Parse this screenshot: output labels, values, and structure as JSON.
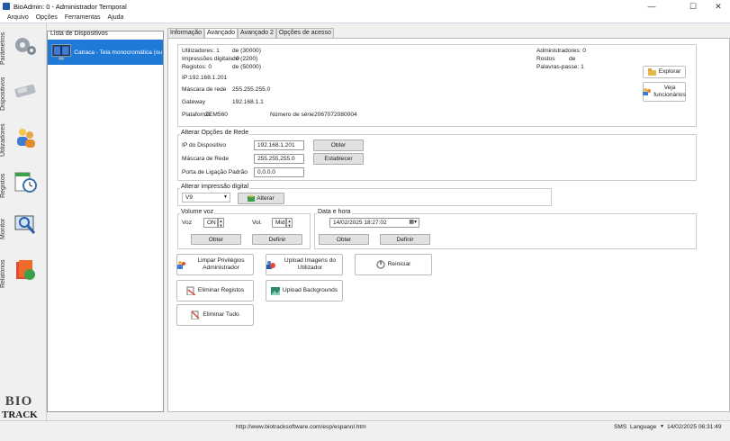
{
  "window": {
    "title": "BioAdmin: 0 - Administrador Temporal"
  },
  "menu": [
    "Arquivo",
    "Opções",
    "Ferramentas",
    "Ajuda"
  ],
  "sidebar": {
    "items": [
      {
        "label": "Parâmetros",
        "icon": "gears-icon"
      },
      {
        "label": "Dispositivos",
        "icon": "devices-icon"
      },
      {
        "label": "Utilizadores",
        "icon": "users-icon"
      },
      {
        "label": "Registos",
        "icon": "clock-icon"
      },
      {
        "label": "Monitor",
        "icon": "monitor-icon"
      },
      {
        "label": "Relatórios",
        "icon": "reports-icon"
      }
    ],
    "logo": {
      "top": "BIO",
      "bottom": "TRACK"
    }
  },
  "devices": {
    "header": "Lista de Dispositivos",
    "items": [
      "Catraca - Tela monocromática (ou se"
    ]
  },
  "tabs": [
    "Informação",
    "Avançado",
    "Avançado 2",
    "Opções de acesso"
  ],
  "info": {
    "utilizadores": "Utilizadores: 1",
    "utilizadores_de": "de (30000)",
    "impressoes": "Impressões digitais: 0",
    "impressoes_de": "de (2200)",
    "registos": "Registos: 0",
    "registos_de": "de (50000)",
    "ip": "IP:192.168.1.201",
    "mascara_label": "Máscara de rede",
    "mascara_value": "255.255.255.0",
    "gateway_label": "Gateway",
    "gateway_value": "192.168.1.1",
    "plataforma_label": "Plataforma",
    "plataforma_value": "ZEM560",
    "serie_label": "Número de série",
    "serie_value": "2067072080004",
    "administradores": "Administradores: 0",
    "rostos": "Rostos",
    "rostos_de": "de",
    "palavras": "Palavras-passe: 1",
    "explorar": "Explorar",
    "veja": "Veja funcionários"
  },
  "rede": {
    "title": "Alterar Opções de Rede",
    "ip_label": "IP do Dispositivo",
    "ip_value": "192.168.1.201",
    "mask_label": "Máscara de Rede",
    "mask_value": "255.255.255.0",
    "port_label": "Porta de Ligação Padrão",
    "port_value": "0.0.0.0",
    "obter": "Obter",
    "establecer": "Establecer"
  },
  "impressao": {
    "title": "Alterar impressão digital",
    "value": "V9",
    "alterar": "Alterar"
  },
  "volume": {
    "title": "Volume voz",
    "voz_label": "Voz",
    "voz_value": "ON",
    "vol_label": "Vol.",
    "vol_value": "Mid",
    "obter": "Obter",
    "definir": "Definir"
  },
  "datahora": {
    "title": "Data e hora",
    "value": "14/02/2025 18:27:02",
    "obter": "Obter",
    "definir": "Definir"
  },
  "actions": {
    "limpar": "Limpar Privilégios Administrador",
    "upload_imagens": "Upload Imagens do Utilizador",
    "reiniciar": "Reiniciar",
    "eliminar_registos": "Eliminar Registos",
    "upload_backgrounds": "Upload Backgrounds",
    "eliminar_tudo": "Eliminar Tudo"
  },
  "status": {
    "url": "http://www.biotracksoftware.com/esp/espanol.htm",
    "sms": "SMS",
    "language": "Language",
    "datetime": "14/02/2025 06:31:49"
  },
  "colors": {
    "accent": "#1e7ad6",
    "titlebar_icon": "#1e5aa8"
  }
}
